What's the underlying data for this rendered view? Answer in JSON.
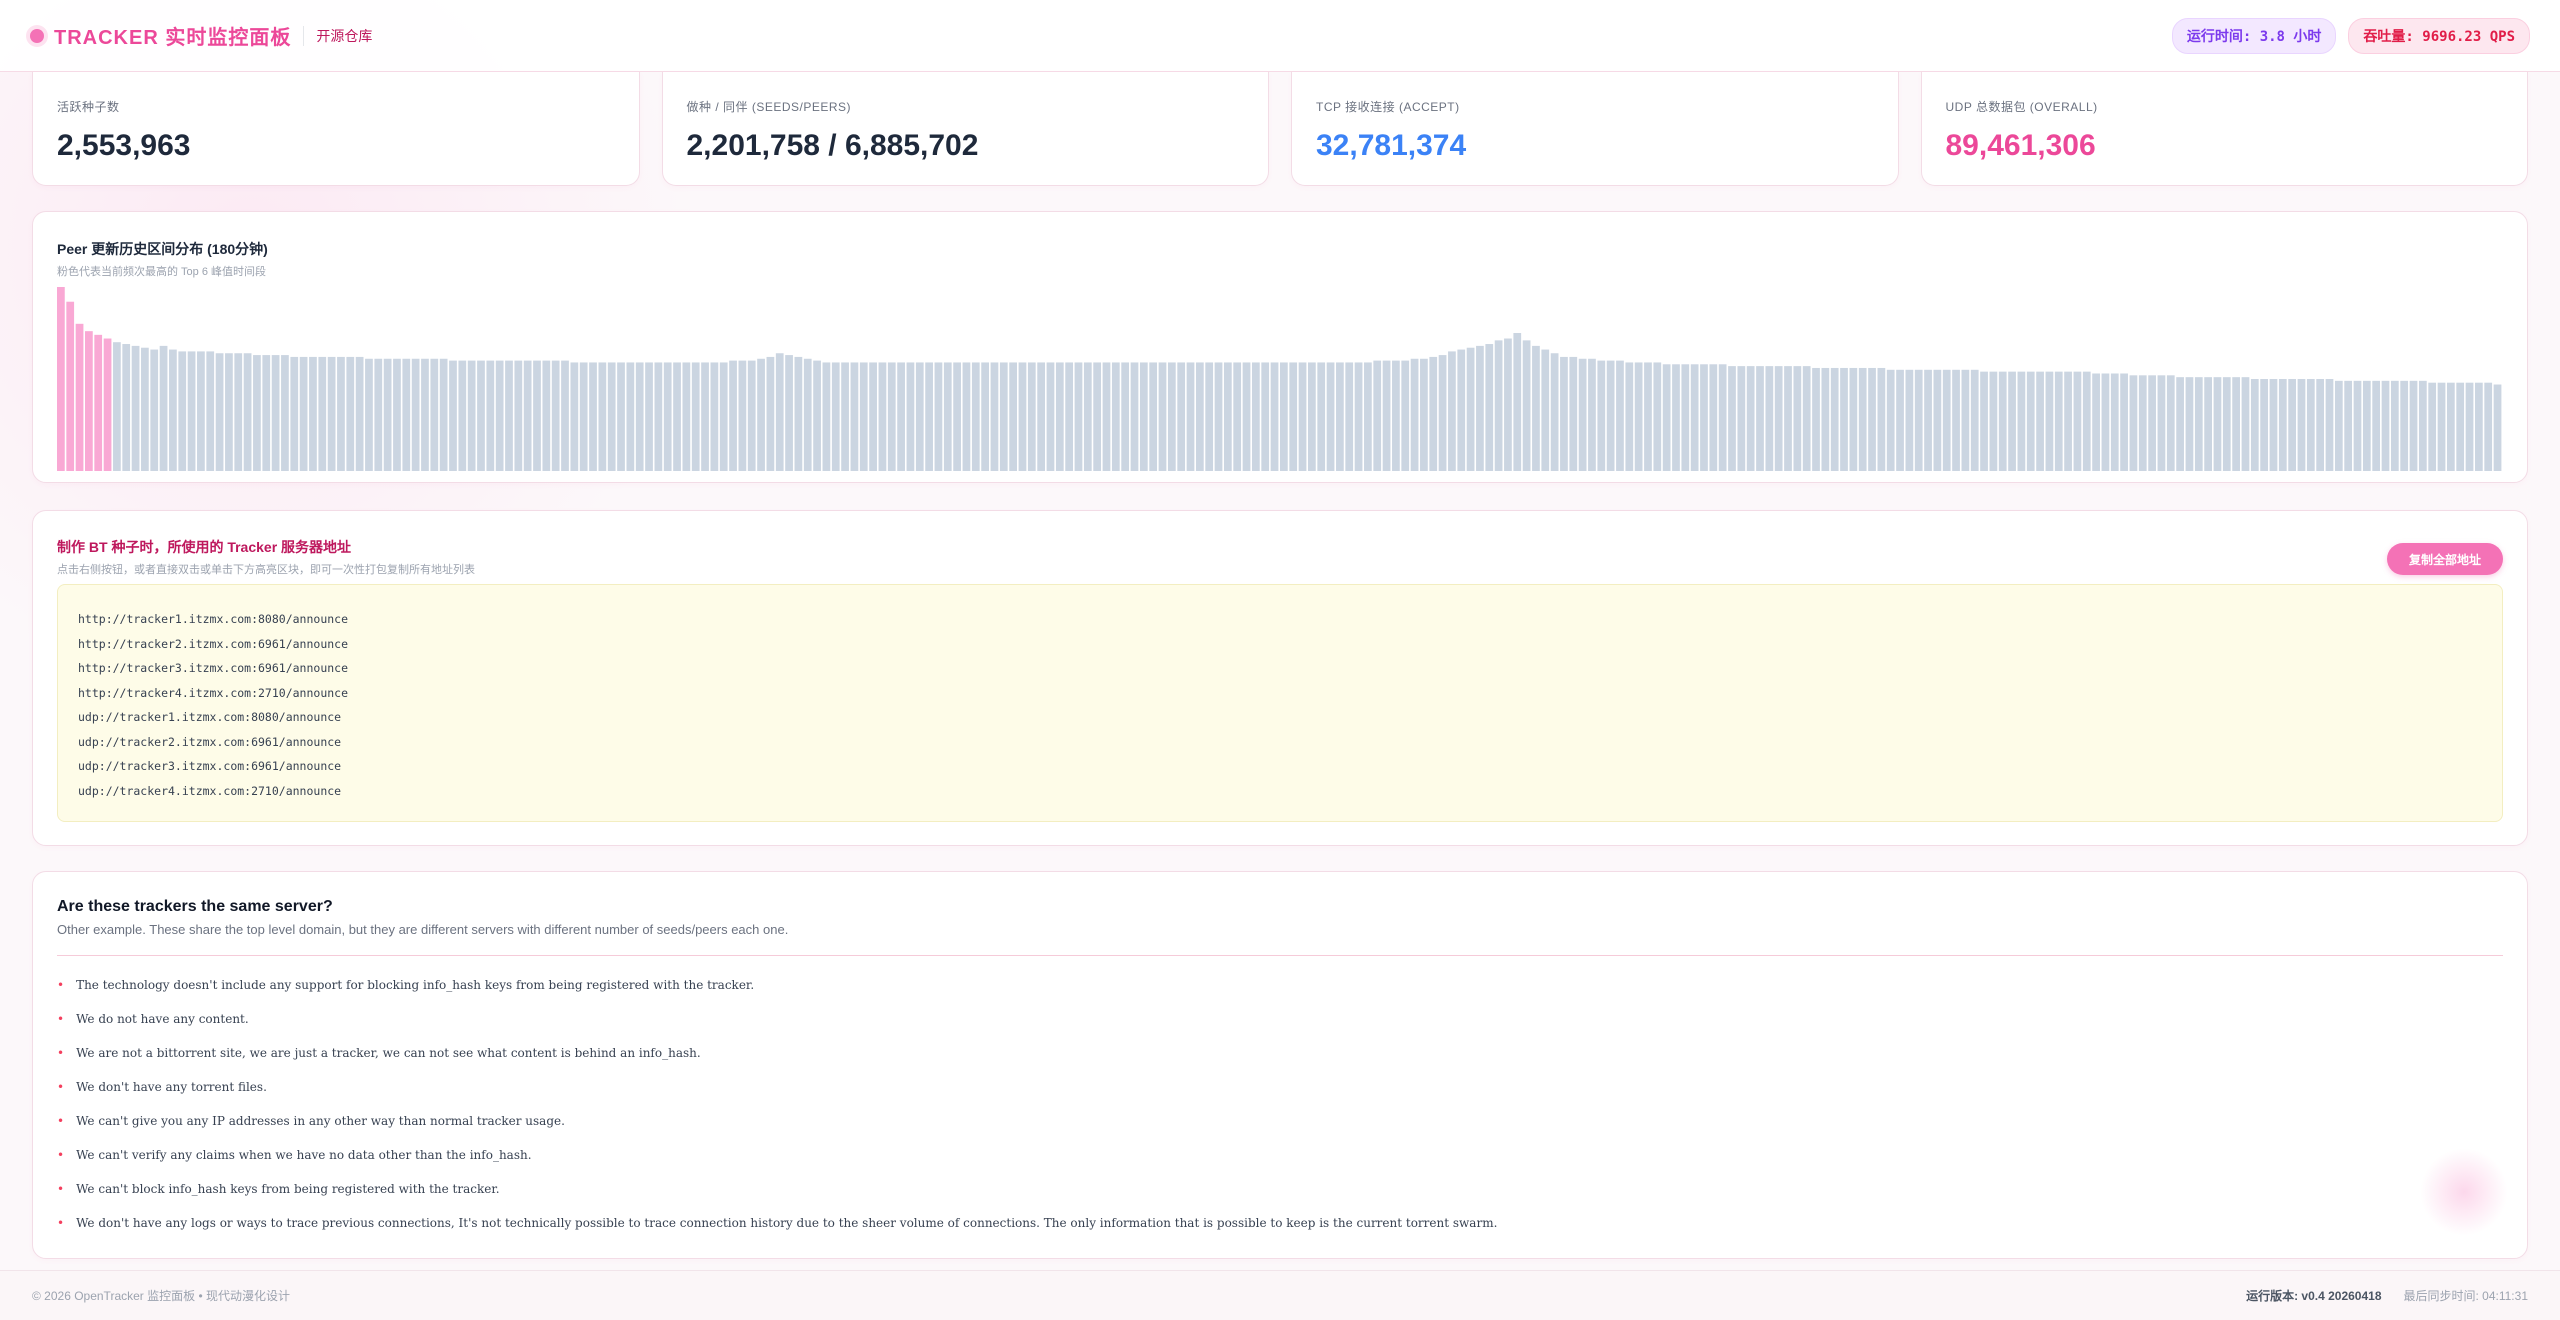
{
  "header": {
    "brand": "TRACKER 实时监控面板",
    "repo_link": "开源仓库",
    "uptime": "运行时间: 3.8 小时",
    "throughput": "吞吐量: 9696.23 QPS"
  },
  "stats": [
    {
      "label": "活跃种子数",
      "value": "2,553,963"
    },
    {
      "label": "做种 / 同伴 (SEEDS/PEERS)",
      "value": "2,201,758 / 6,885,702"
    },
    {
      "label": "TCP 接收连接 (ACCEPT)",
      "value": "32,781,374"
    },
    {
      "label": "UDP 总数据包 (OVERALL)",
      "value": "89,461,306"
    }
  ],
  "chart": {
    "title": "Peer 更新历史区间分布 (180分钟)",
    "subtitle": "粉色代表当前频次最高的 Top 6 峰值时间段"
  },
  "chart_data": {
    "type": "bar",
    "colors": {
      "highlight": "#f9a8d4",
      "default": "#cbd5e1"
    },
    "values": [
      100,
      92,
      80,
      76,
      74,
      72,
      70,
      69,
      68,
      67,
      66,
      68,
      66,
      65,
      65,
      65,
      65,
      64,
      64,
      64,
      64,
      63,
      63,
      63,
      63,
      62,
      62,
      62,
      62,
      62,
      62,
      62,
      62,
      61,
      61,
      61,
      61,
      61,
      61,
      61,
      61,
      61,
      60,
      60,
      60,
      60,
      60,
      60,
      60,
      60,
      60,
      60,
      60,
      60,
      60,
      59,
      59,
      59,
      59,
      59,
      59,
      59,
      59,
      59,
      59,
      59,
      59,
      59,
      59,
      59,
      59,
      59,
      60,
      60,
      60,
      61,
      62,
      64,
      63,
      62,
      61,
      60,
      59,
      59,
      59,
      59,
      59,
      59,
      59,
      59,
      59,
      59,
      59,
      59,
      59,
      59,
      59,
      59,
      59,
      59,
      59,
      59,
      59,
      59,
      59,
      59,
      59,
      59,
      59,
      59,
      59,
      59,
      59,
      59,
      59,
      59,
      59,
      59,
      59,
      59,
      59,
      59,
      59,
      59,
      59,
      59,
      59,
      59,
      59,
      59,
      59,
      59,
      59,
      59,
      59,
      59,
      59,
      59,
      59,
      59,
      59,
      60,
      60,
      60,
      60,
      61,
      61,
      62,
      63,
      65,
      66,
      67,
      68,
      69,
      71,
      72,
      75,
      71,
      68,
      66,
      64,
      62,
      62,
      61,
      61,
      60,
      60,
      60,
      59,
      59,
      59,
      59,
      58,
      58,
      58,
      58,
      58,
      58,
      58,
      57,
      57,
      57,
      57,
      57,
      57,
      57,
      57,
      57,
      56,
      56,
      56,
      56,
      56,
      56,
      56,
      56,
      55,
      55,
      55,
      55,
      55,
      55,
      55,
      55,
      55,
      55,
      54,
      54,
      54,
      54,
      54,
      54,
      54,
      54,
      54,
      54,
      54,
      54,
      53,
      53,
      53,
      53,
      52,
      52,
      52,
      52,
      52,
      51,
      51,
      51,
      51,
      51,
      51,
      51,
      51,
      50,
      50,
      50,
      50,
      50,
      50,
      50,
      50,
      50,
      49,
      49,
      49,
      49,
      49,
      49,
      49,
      49,
      49,
      49,
      48,
      48,
      48,
      48,
      48,
      48,
      48,
      47
    ],
    "highlight_count": 6
  },
  "trackers": {
    "title": "制作 BT 种子时，所使用的 Tracker 服务器地址",
    "subtitle": "点击右侧按钮，或者直接双击或单击下方高亮区块，即可一次性打包复制所有地址列表",
    "copy_button": "复制全部地址",
    "urls": [
      "http://tracker1.itzmx.com:8080/announce",
      "http://tracker2.itzmx.com:6961/announce",
      "http://tracker3.itzmx.com:6961/announce",
      "http://tracker4.itzmx.com:2710/announce",
      "udp://tracker1.itzmx.com:8080/announce",
      "udp://tracker2.itzmx.com:6961/announce",
      "udp://tracker3.itzmx.com:6961/announce",
      "udp://tracker4.itzmx.com:2710/announce"
    ]
  },
  "faq": {
    "title": "Are these trackers the same server?",
    "subtitle": "Other example. These share the top level domain, but they are different servers with different number of seeds/peers each one.",
    "bullet": "•",
    "items": [
      "The technology doesn't include any support for blocking info_hash keys from being registered with the tracker.",
      "We do not have any content.",
      "We are not a bittorrent site, we are just a tracker, we can not see what content is behind an info_hash.",
      "We don't have any torrent files.",
      "We can't give you any IP addresses in any other way than normal tracker usage.",
      "We can't verify any claims when we have no data other than the info_hash.",
      "We can't block info_hash keys from being registered with the tracker.",
      "We don't have any logs or ways to trace previous connections, It's not technically possible to trace connection history due to the sheer volume of connections. The only information that is possible to keep is the current torrent swarm."
    ]
  },
  "footer": {
    "copyright": "© 2026 OpenTracker 监控面板 • 现代动漫化设计",
    "version": "运行版本: v0.4 20260418",
    "last_sync": "最后同步时间: 04:11:31"
  }
}
